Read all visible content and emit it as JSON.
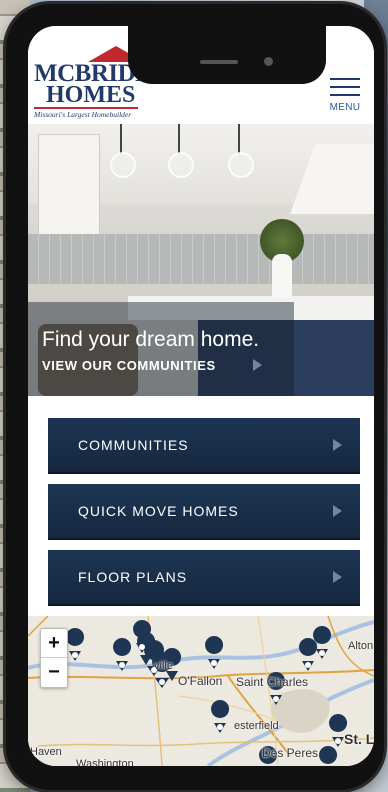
{
  "header": {
    "logo": {
      "line1": "MCBRIDE",
      "line2": "HOMES",
      "tagline": "Missouri's Largest Homebuilder"
    },
    "menu_label": "MENU"
  },
  "hero": {
    "heading": "Find your dream home.",
    "link_label": "VIEW OUR COMMUNITIES"
  },
  "nav_buttons": [
    {
      "label": "COMMUNITIES"
    },
    {
      "label": "QUICK MOVE HOMES"
    },
    {
      "label": "FLOOR PLANS"
    }
  ],
  "map": {
    "zoom_in": "+",
    "zoom_out": "−",
    "place_labels": [
      "ville",
      "O'Fallon",
      "Saint Charles",
      "Alton",
      "esterfield",
      "Des Peres",
      "Haven",
      "Washington",
      "St. Lou"
    ]
  },
  "colors": {
    "brand_navy": "#1f3a6b",
    "brand_red": "#c0282d",
    "button_navy": "#1d3553",
    "marker_navy": "#1e3553"
  }
}
